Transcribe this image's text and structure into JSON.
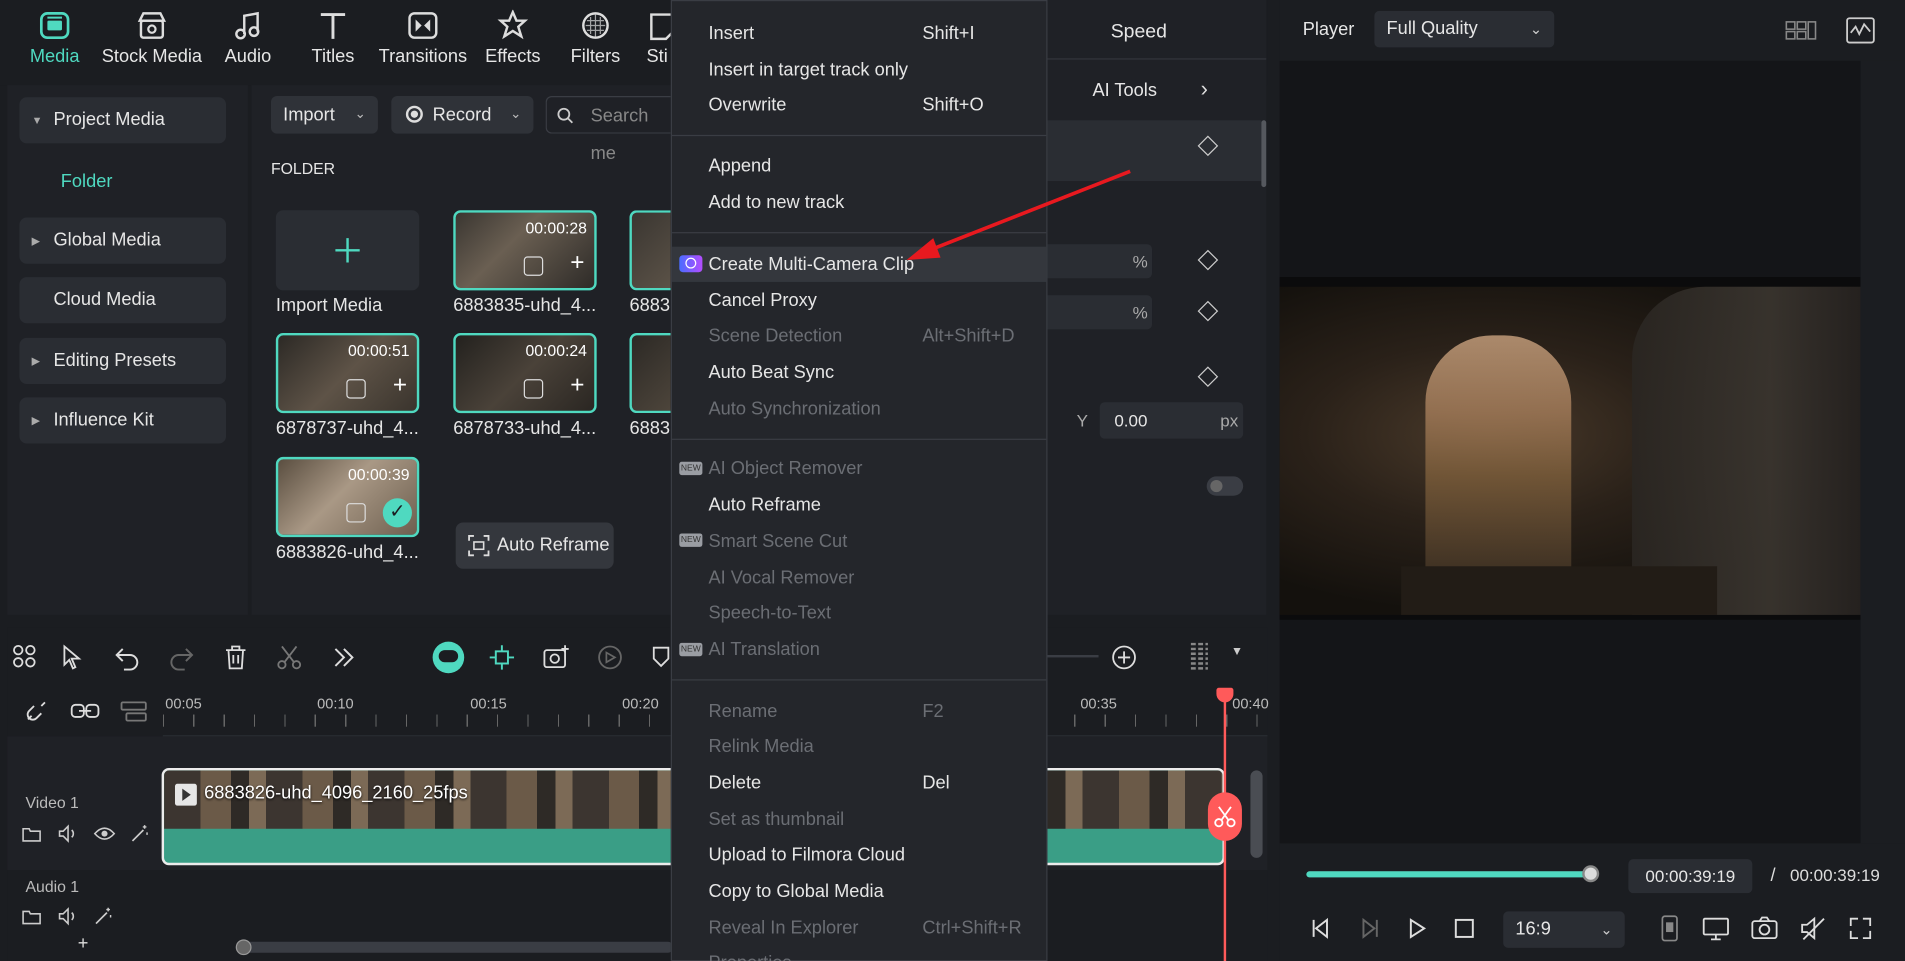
{
  "toolbar": {
    "tabs": [
      {
        "label": "Media",
        "icon": "media-icon"
      },
      {
        "label": "Stock Media",
        "icon": "stock-media-icon"
      },
      {
        "label": "Audio",
        "icon": "music-note-icon"
      },
      {
        "label": "Titles",
        "icon": "text-t-icon"
      },
      {
        "label": "Transitions",
        "icon": "transitions-icon"
      },
      {
        "label": "Effects",
        "icon": "effects-icon"
      },
      {
        "label": "Filters",
        "icon": "filters-icon"
      },
      {
        "label": "Sti",
        "icon": "stickers-icon"
      }
    ]
  },
  "sidebar": {
    "items": [
      {
        "label": "Project Media"
      },
      {
        "label": "Folder"
      },
      {
        "label": "Global Media"
      },
      {
        "label": "Cloud Media"
      },
      {
        "label": "Editing Presets"
      },
      {
        "label": "Influence Kit"
      }
    ]
  },
  "media": {
    "import_label": "Import",
    "record_label": "Record",
    "search_placeholder": "Search me",
    "folder_heading": "FOLDER",
    "import_media_label": "Import Media",
    "auto_reframe_label": "Auto Reframe",
    "clips": [
      {
        "name": "6883835-uhd_4...",
        "duration": "00:00:28"
      },
      {
        "name": "6883",
        "duration": ""
      },
      {
        "name": "6878737-uhd_4...",
        "duration": "00:00:51"
      },
      {
        "name": "6878733-uhd_4...",
        "duration": "00:00:24"
      },
      {
        "name": "6883",
        "duration": ""
      },
      {
        "name": "6883826-uhd_4...",
        "duration": "00:00:39"
      }
    ]
  },
  "context_menu": {
    "items": [
      {
        "label": "Insert",
        "shortcut": "Shift+I"
      },
      {
        "label": "Insert in target track only",
        "shortcut": ""
      },
      {
        "label": "Overwrite",
        "shortcut": "Shift+O"
      },
      {
        "label": "Append",
        "shortcut": ""
      },
      {
        "label": "Add to new track",
        "shortcut": ""
      },
      {
        "label": "Create Multi-Camera Clip",
        "shortcut": ""
      },
      {
        "label": "Cancel Proxy",
        "shortcut": ""
      },
      {
        "label": "Scene Detection",
        "shortcut": "Alt+Shift+D"
      },
      {
        "label": "Auto Beat Sync",
        "shortcut": ""
      },
      {
        "label": "Auto Synchronization",
        "shortcut": ""
      },
      {
        "label": "AI Object Remover",
        "shortcut": ""
      },
      {
        "label": "Auto Reframe",
        "shortcut": ""
      },
      {
        "label": "Smart Scene Cut",
        "shortcut": ""
      },
      {
        "label": "AI Vocal Remover",
        "shortcut": ""
      },
      {
        "label": "Speech-to-Text",
        "shortcut": ""
      },
      {
        "label": "AI Translation",
        "shortcut": ""
      },
      {
        "label": "Rename",
        "shortcut": "F2"
      },
      {
        "label": "Relink Media",
        "shortcut": ""
      },
      {
        "label": "Delete",
        "shortcut": "Del"
      },
      {
        "label": "Set as thumbnail",
        "shortcut": ""
      },
      {
        "label": "Upload to Filmora Cloud",
        "shortcut": ""
      },
      {
        "label": "Copy to Global Media",
        "shortcut": ""
      },
      {
        "label": "Reveal In Explorer",
        "shortcut": "Ctrl+Shift+R"
      },
      {
        "label": "Properties",
        "shortcut": ""
      }
    ],
    "new_badge": "NEW"
  },
  "properties": {
    "speed_tab": "Speed",
    "ai_tools_label": "AI Tools",
    "percent_unit": "%",
    "y_label": "Y",
    "y_value": "0.00",
    "y_unit": "px"
  },
  "player": {
    "label": "Player",
    "quality": "Full Quality",
    "current_time": "00:00:39:19",
    "time_separator": "/",
    "total_time": "00:00:39:19",
    "aspect": "16:9",
    "progress": 1.0
  },
  "timeline": {
    "ticks": [
      "00:05",
      "00:10",
      "00:15",
      "00:20",
      "00:35",
      "00:40"
    ],
    "video_track": "Video 1",
    "audio_track": "Audio 1",
    "clip_name": "6883826-uhd_4096_2160_25fps",
    "add_label": "+"
  },
  "colors": {
    "accent": "#4fd9c0",
    "playhead": "#ff5a5a",
    "arrow": "#e8191f"
  }
}
